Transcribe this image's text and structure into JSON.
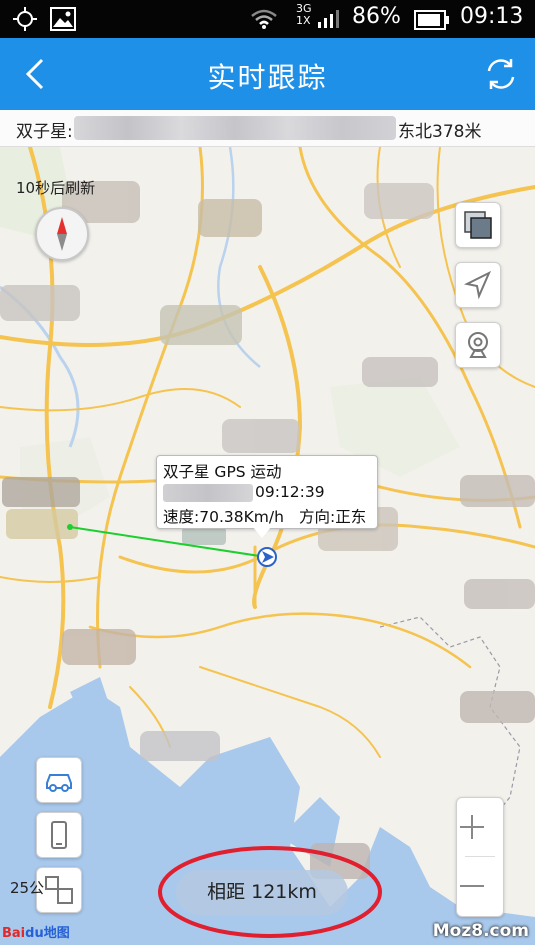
{
  "status_bar": {
    "network": "3G",
    "sim": "1X",
    "battery": "86%",
    "time": "09:13"
  },
  "header": {
    "title": "实时跟踪",
    "back_icon": "chevron-left-icon",
    "refresh_icon": "refresh-icon"
  },
  "info_bar": {
    "label": "双子星:",
    "distance_text": "东北378米"
  },
  "map": {
    "refresh_note": "10秒后刷新",
    "popup": {
      "line1": "双子星 GPS 运动",
      "time": "09:12:39",
      "speed": "速度:70.38Km/h",
      "direction": "方向:正东"
    },
    "distance_pill": "相距 121km",
    "scale": "25公",
    "logo_text": "Bai",
    "logo_suffix": "du地图",
    "watermark": "Moz8.com"
  },
  "colors": {
    "header_bg": "#1e90e8",
    "road": "#f5c34f",
    "sea": "#a8c8ec",
    "track": "#1bcf2e",
    "highlight_ring": "#e01f2f"
  }
}
